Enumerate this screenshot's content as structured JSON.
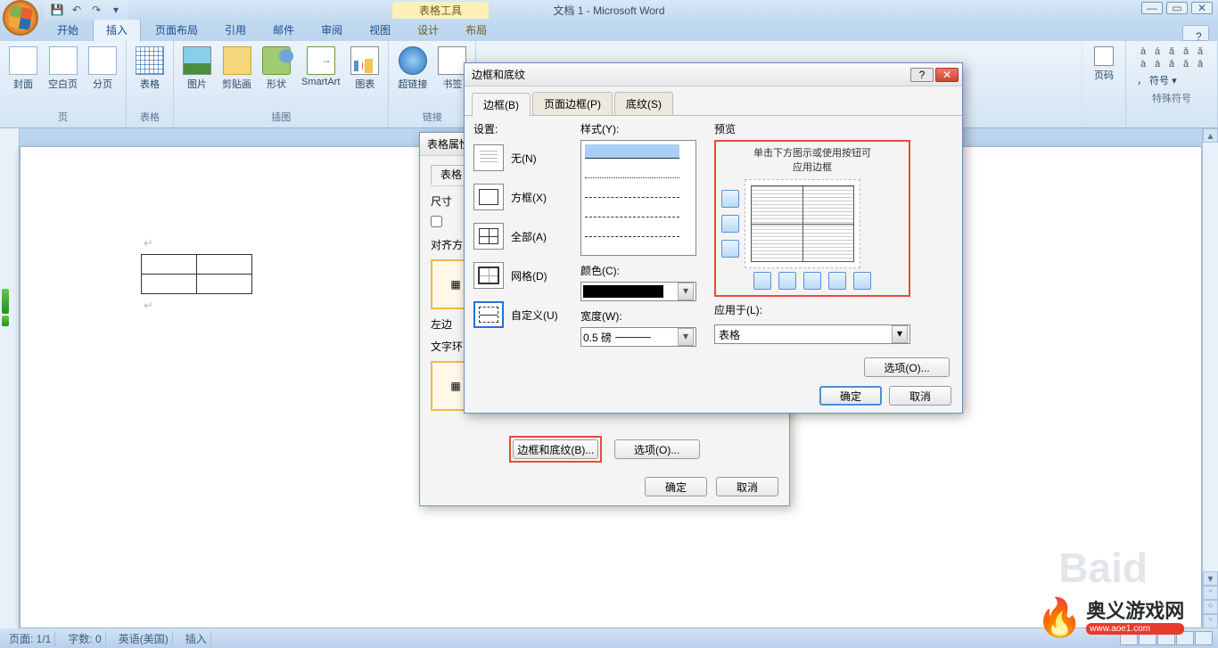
{
  "app": {
    "title": "文档 1 - Microsoft Word",
    "context_tab": "表格工具"
  },
  "tabs": {
    "t0": "开始",
    "t1": "插入",
    "t2": "页面布局",
    "t3": "引用",
    "t4": "邮件",
    "t5": "审阅",
    "t6": "视图",
    "t7": "设计",
    "t8": "布局"
  },
  "ribbon": {
    "pages": {
      "label": "页",
      "cover": "封面",
      "blank": "空白页",
      "break": "分页"
    },
    "tables": {
      "label": "表格",
      "table": "表格"
    },
    "illus": {
      "label": "插图",
      "pic": "图片",
      "clip": "剪贴画",
      "shapes": "形状",
      "smartart": "SmartArt",
      "chart": "图表"
    },
    "links": {
      "label": "链接",
      "hyper": "超链接",
      "bookmark": "书签"
    },
    "hf": {
      "pagenum": "页码"
    },
    "symbols": {
      "label": "特殊符号",
      "row": "， 符号 ▾"
    }
  },
  "sym_grid": [
    "à",
    "á",
    "ǎ",
    "ǎ",
    "ǎ",
    "à",
    "á",
    "ǎ",
    "ǎ",
    "ǎ"
  ],
  "dlg1": {
    "title": "表格属性",
    "tab": "表格",
    "size": "尺寸",
    "align": "对齐方",
    "wrap": "文字环",
    "around": "左边",
    "borders_btn": "边框和底纹(B)...",
    "options_btn": "选项(O)...",
    "ok": "确定",
    "cancel": "取消"
  },
  "dlg2": {
    "title": "边框和底纹",
    "tabs": {
      "t0": "边框(B)",
      "t1": "页面边框(P)",
      "t2": "底纹(S)"
    },
    "col_setting": "设置:",
    "settings": {
      "none": "无(N)",
      "box": "方框(X)",
      "all": "全部(A)",
      "grid": "网格(D)",
      "custom": "自定义(U)"
    },
    "col_style": "样式(Y):",
    "color_lbl": "颜色(C):",
    "width_lbl": "宽度(W):",
    "width_val": "0.5 磅",
    "col_preview": "预览",
    "preview_msg": "单击下方图示或使用按钮可",
    "preview_msg2": "应用边框",
    "apply_lbl": "应用于(L):",
    "apply_val": "表格",
    "options_btn": "选项(O)...",
    "ok": "确定",
    "cancel": "取消"
  },
  "status": {
    "page": "页面: 1/1",
    "words": "字数: 0",
    "lang": "英语(美国)",
    "mode": "插入"
  },
  "watermark": {
    "baidu": "Baid",
    "site_cn": "奥义游戏网",
    "site_url": "www.aoe1.com"
  }
}
